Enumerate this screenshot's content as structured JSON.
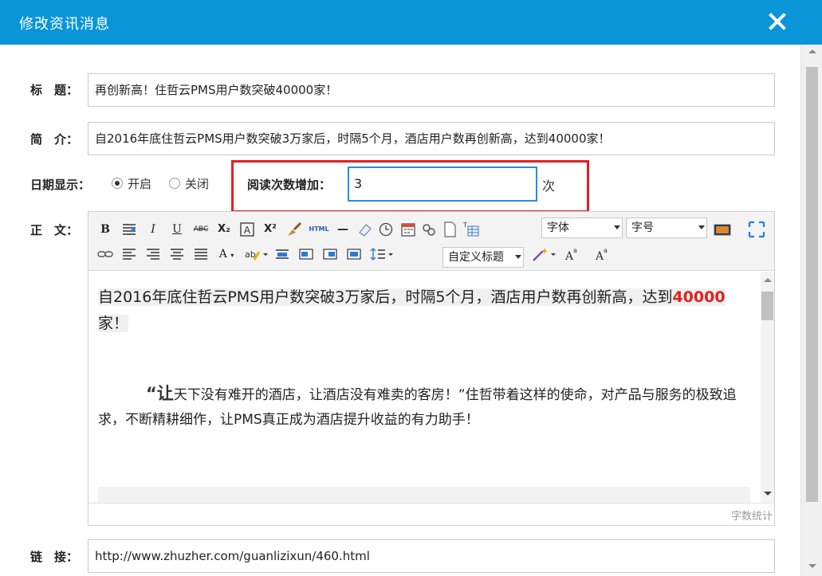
{
  "dialog": {
    "title": "修改资讯消息"
  },
  "form": {
    "title_label": "标　题：",
    "title_value": "再创新高！住哲云PMS用户数突破40000家！",
    "summary_label": "简　介：",
    "summary_value": "自2016年底住哲云PMS用户数突破3万家后，时隔5个月，酒店用户数再创新高，达到40000家！",
    "date_label": "日期显示：",
    "date_options": [
      "开启",
      "关闭"
    ],
    "date_selected": "开启",
    "read_label": "阅读次数增加：",
    "read_value": "3",
    "read_unit": "次",
    "body_label": "正　文：",
    "link_label": "链　接：",
    "link_value": "http://www.zhuzher.com/guanlizixun/460.html"
  },
  "editor": {
    "font_select": "字体",
    "size_select": "字号",
    "heading_select": "自定义标题",
    "word_count": "字数统计",
    "toolbar_text": {
      "bold": "B",
      "italic": "I",
      "underline": "U",
      "strike": "ABC",
      "sub": "X₂",
      "sup": "X²",
      "html": "HTML",
      "hr": "—",
      "font_color": "A"
    },
    "para1": {
      "text_a": "自2016年底住哲云PMS用户数突破3万家后，时隔5个月，酒店用户数再创新高，达到",
      "highlight_number": "40000",
      "text_b": "家！"
    },
    "para2": {
      "quote_open": "“让",
      "text": "天下没有难开的酒店，让酒店没有难卖的客房！”住哲带着这样的使命，对产品与服务的极致追求，不断精耕细作，让PMS真正成为酒店提升收益的有力助手！"
    }
  },
  "colors": {
    "header": "#0a95d8",
    "highlight_border": "#e02020",
    "input_focus": "#2e8be0",
    "accent_text": "#e02020"
  }
}
